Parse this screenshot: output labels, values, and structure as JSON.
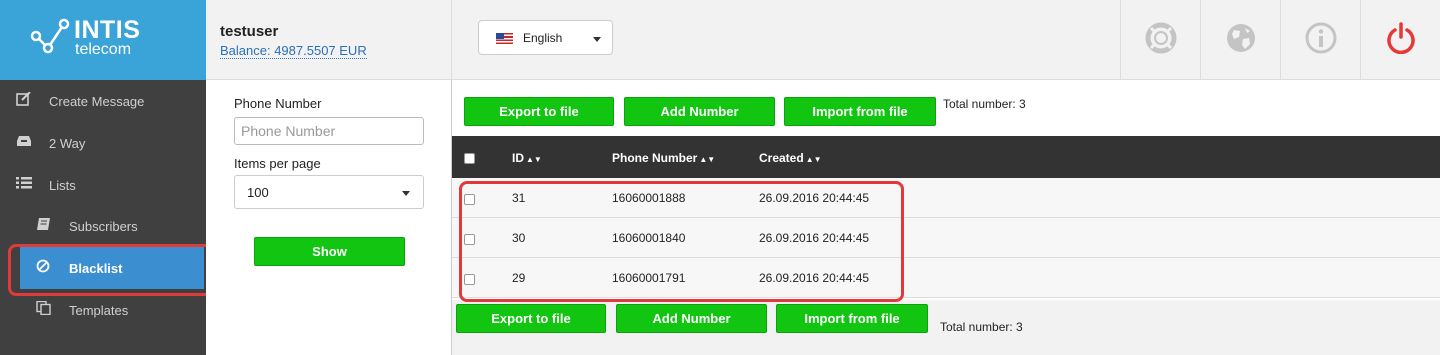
{
  "brand": {
    "name": "INTIS",
    "sub": "telecom"
  },
  "user": {
    "name": "testuser",
    "balance": "Balance: 4987.5507 EUR"
  },
  "language": {
    "selected": "English"
  },
  "header_icons": [
    "lifebuoy-icon",
    "globe-icon",
    "info-icon",
    "power-icon"
  ],
  "colors": {
    "brand": "#3aa3d8",
    "active_nav": "#3b8ed0",
    "button_green": "#11c511",
    "highlight": "#e03a3a",
    "sidebar": "#404040",
    "table_header": "#333333",
    "power": "#e53935"
  },
  "sidebar": {
    "items": [
      {
        "label": "Create Message",
        "icon": "edit-icon"
      },
      {
        "label": "2 Way",
        "icon": "inbox-icon"
      },
      {
        "label": "Lists",
        "icon": "list-icon"
      },
      {
        "label": "Subscribers",
        "icon": "book-icon"
      },
      {
        "label": "Blacklist",
        "icon": "ban-icon"
      },
      {
        "label": "Templates",
        "icon": "copy-icon"
      }
    ],
    "active": "Blacklist"
  },
  "filter": {
    "phone_label": "Phone Number",
    "phone_placeholder": "Phone Number",
    "per_page_label": "Items per page",
    "per_page_value": "100",
    "show_label": "Show"
  },
  "toolbar": {
    "export_label": "Export to file",
    "add_label": "Add Number",
    "import_label": "Import from file",
    "total": "Total number: 3"
  },
  "table": {
    "columns": [
      "ID",
      "Phone Number",
      "Created"
    ],
    "rows": [
      {
        "id": "31",
        "phone": "16060001888",
        "created": "26.09.2016 20:44:45"
      },
      {
        "id": "30",
        "phone": "16060001840",
        "created": "26.09.2016 20:44:45"
      },
      {
        "id": "29",
        "phone": "16060001791",
        "created": "26.09.2016 20:44:45"
      }
    ]
  }
}
